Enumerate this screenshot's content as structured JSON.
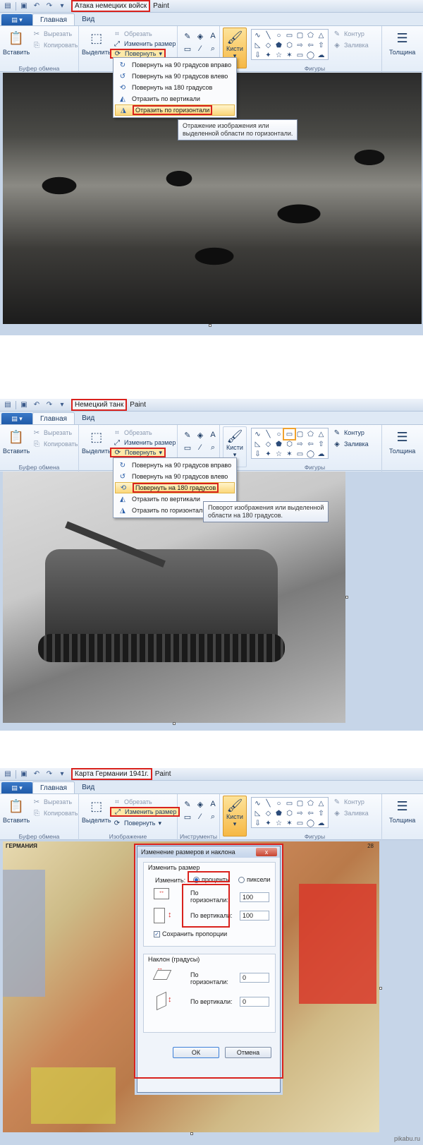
{
  "app_name": "Paint",
  "tabs": {
    "file_icon": "file-menu-icon",
    "home": "Главная",
    "view": "Вид"
  },
  "clipboard": {
    "paste": "Вставить",
    "cut": "Вырезать",
    "copy": "Копировать",
    "label": "Буфер обмена"
  },
  "image": {
    "select": "Выделить",
    "crop": "Обрезать",
    "resize": "Изменить размер",
    "rotate": "Повернуть",
    "label": "Изображение"
  },
  "tools": {
    "label": "Инструменты"
  },
  "brushes": {
    "label": "Кисти"
  },
  "shapes": {
    "outline": "Контур",
    "fill": "Заливка",
    "label": "Фигуры"
  },
  "size": {
    "label": "Толщина"
  },
  "panel1": {
    "doc_title": "Атака немецких войск",
    "menu": [
      "Повернуть на 90 градусов вправо",
      "Повернуть на 90 градусов влево",
      "Повернуть на 180 градусов",
      "Отразить по вертикали",
      "Отразить по горизонтали"
    ],
    "tooltip_line1": "Отражение изображения или",
    "tooltip_line2": "выделенной области по горизонтали."
  },
  "panel2": {
    "doc_title": "Немецкий танк",
    "menu": [
      "Повернуть на 90 градусов вправо",
      "Повернуть на 90 градусов влево",
      "Повернуть на 180 градусов",
      "Отразить по вертикали",
      "Отразить по горизонтали"
    ],
    "tooltip_line1": "Поворот изображения или выделенной",
    "tooltip_line2": "области на 180 градусов."
  },
  "panel3": {
    "doc_title": "Карта Германии 1941г.",
    "map_title": "ГЕРМАНИЯ",
    "map_page": "28",
    "dialog": {
      "title": "Изменение размеров и наклона",
      "close": "x",
      "resize_section": "Изменить размер",
      "by_label": "Изменить:",
      "percent": "проценты",
      "pixels": "пиксели",
      "horizontal": "По горизонтали:",
      "vertical": "По вертикали:",
      "h_value": "100",
      "v_value": "100",
      "keep_ratio": "Сохранить пропорции",
      "skew_section": "Наклон (градусы)",
      "skew_h": "0",
      "skew_v": "0",
      "ok": "ОК",
      "cancel": "Отмена"
    }
  },
  "watermark": "pikabu.ru"
}
